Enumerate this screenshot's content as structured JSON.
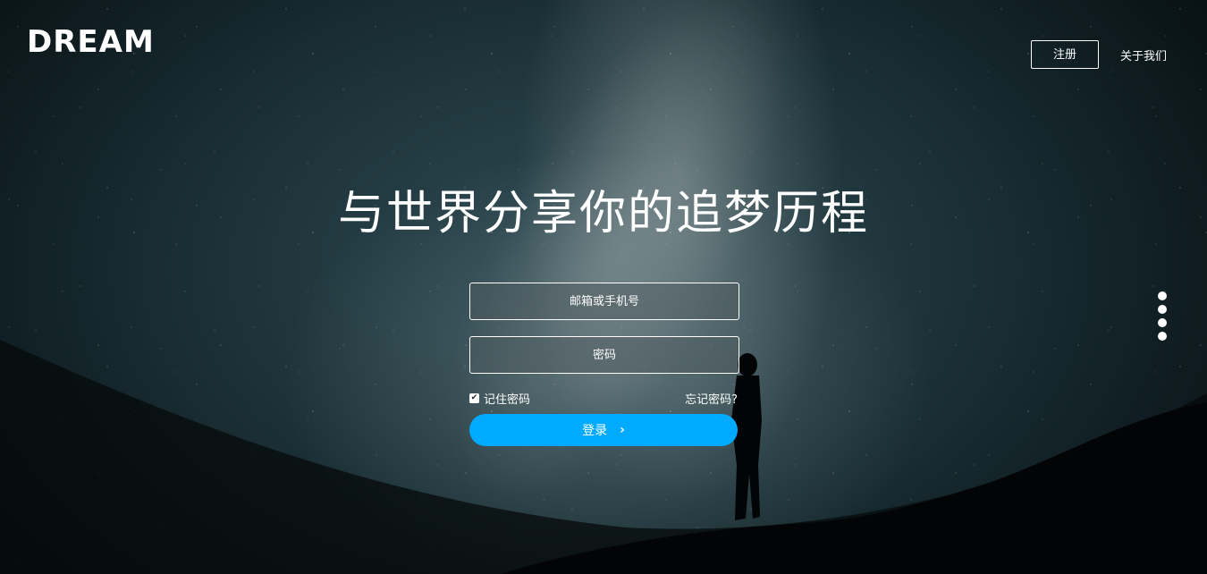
{
  "header": {
    "logo_text": "DREAM",
    "register_label": "注册",
    "about_label": "关于我们"
  },
  "hero": {
    "headline": "与世界分享你的追梦历程"
  },
  "login_form": {
    "account_placeholder": "邮箱或手机号",
    "password_placeholder": "密码",
    "remember_label": "记住密码",
    "remember_checked": true,
    "forgot_label": "忘记密码?",
    "submit_label": "登录",
    "submit_icon": "chevron-right-icon"
  },
  "pagination": {
    "dot_count": 4
  },
  "colors": {
    "accent": "#00aaff",
    "text": "#ffffff"
  }
}
